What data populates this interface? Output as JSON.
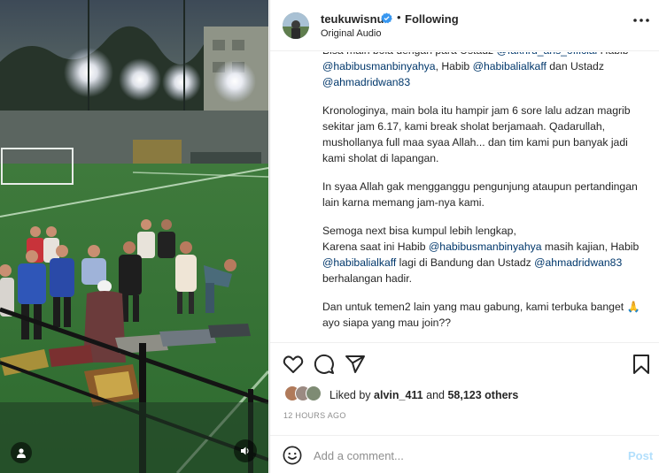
{
  "post": {
    "username": "teukuwisnu",
    "verified": true,
    "separator": "•",
    "follow_status": "Following",
    "audio": "Original Audio",
    "more_icon": "more-horizontal-icon"
  },
  "caption": {
    "paragraphs": [
      {
        "segments": [
          {
            "text": "Bisa main bola dengan para Ustadz "
          },
          {
            "text": "@fakhru_ans_official",
            "mention": true
          },
          {
            "text": " Habib "
          },
          {
            "text": "@habibusmanbinyahya",
            "mention": true
          },
          {
            "text": ", Habib "
          },
          {
            "text": "@habibalialkaff",
            "mention": true
          },
          {
            "text": " dan Ustadz "
          },
          {
            "text": "@ahmadridwan83",
            "mention": true
          }
        ]
      },
      {
        "segments": [
          {
            "text": "Kronologinya, main bola itu hampir jam 6 sore lalu adzan magrib sekitar jam 6.17, kami break sholat berjamaah. Qadarullah, mushollanya full maa syaa Allah... dan tim kami pun banyak jadi kami sholat di lapangan."
          }
        ]
      },
      {
        "segments": [
          {
            "text": "In syaa Allah gak mengganggu pengunjung ataupun pertandingan lain karna memang jam-nya kami."
          }
        ]
      },
      {
        "segments": [
          {
            "text": "Semoga next bisa kumpul lebih lengkap,\nKarena saat ini Habib "
          },
          {
            "text": "@habibusmanbinyahya",
            "mention": true
          },
          {
            "text": " masih kajian, Habib "
          },
          {
            "text": "@habibalialkaff",
            "mention": true
          },
          {
            "text": " lagi di Bandung dan Ustadz "
          },
          {
            "text": "@ahmadridwan83",
            "mention": true
          },
          {
            "text": " berhalangan hadir."
          }
        ]
      },
      {
        "segments": [
          {
            "text": "Dan untuk temen2 lain yang mau gabung, kami terbuka banget 🙏\nayo siapa yang mau join??"
          }
        ]
      }
    ],
    "meta": "12j"
  },
  "actions": {
    "like_icon": "heart-icon",
    "comment_icon": "comment-icon",
    "share_icon": "send-icon",
    "save_icon": "bookmark-icon"
  },
  "likes": {
    "prefix": "Liked by ",
    "first_user": "alvin_411",
    "middle": " and ",
    "count": "58,123 others"
  },
  "timestamp": "12 HOURS AGO",
  "comment": {
    "placeholder": "Add a comment...",
    "post_label": "Post",
    "emoji_icon": "smiley-icon"
  },
  "media": {
    "user_icon": "user-tag-icon",
    "audio_icon": "speaker-icon"
  },
  "colors": {
    "mention": "#00376b",
    "post_disabled": "#b2dffc",
    "verified": "#3897f0",
    "secondary_text": "#8e8e8e"
  }
}
